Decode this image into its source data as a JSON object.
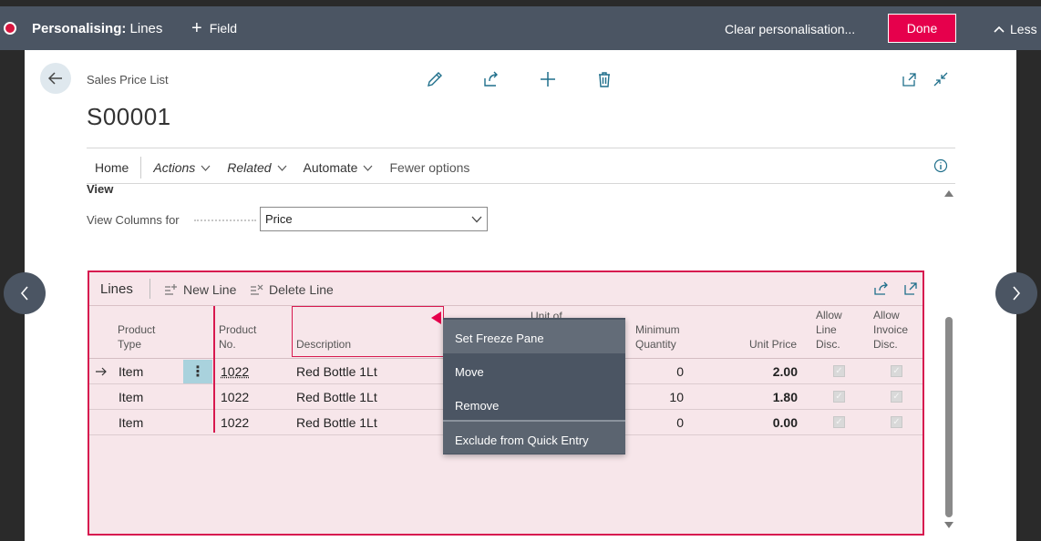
{
  "personalise_bar": {
    "title_bold": "Personalising:",
    "title_rest": "Lines",
    "field_label": "Field",
    "clear_label": "Clear personalisation...",
    "done_label": "Done",
    "less_label": "Less"
  },
  "page": {
    "breadcrumb": "Sales Price List",
    "title": "S00001"
  },
  "actionbar": {
    "items": [
      "Home",
      "Actions",
      "Related",
      "Automate",
      "Fewer options"
    ]
  },
  "view": {
    "section_label": "View",
    "columns_label": "View Columns for",
    "columns_value": "Price"
  },
  "lines": {
    "title": "Lines",
    "new_line": "New Line",
    "delete_line": "Delete Line",
    "columns": {
      "product_type": [
        "Product",
        "Type"
      ],
      "product_no": [
        "Product",
        "No."
      ],
      "description": "Description",
      "unit_of": "Unit of",
      "min_qty": [
        "Minimum",
        "Quantity"
      ],
      "unit_price": "Unit Price",
      "allow_line_disc": [
        "Allow",
        "Line",
        "Disc."
      ],
      "allow_invoice_disc": [
        "Allow",
        "Invoice",
        "Disc."
      ]
    },
    "rows": [
      {
        "type": "Item",
        "no": "1022",
        "description": "Red Bottle 1Lt",
        "min_qty": "0",
        "unit_price": "2.00"
      },
      {
        "type": "Item",
        "no": "1022",
        "description": "Red Bottle 1Lt",
        "min_qty": "10",
        "unit_price": "1.80"
      },
      {
        "type": "Item",
        "no": "1022",
        "description": "Red Bottle 1Lt",
        "min_qty": "0",
        "unit_price": "0.00"
      }
    ]
  },
  "context_menu": {
    "items": [
      "Set Freeze Pane",
      "Move",
      "Remove",
      "Exclude from Quick Entry"
    ]
  },
  "colors": {
    "accent": "#e6004c",
    "bar": "#4b5563",
    "lines_bg": "#f7e6ea"
  }
}
